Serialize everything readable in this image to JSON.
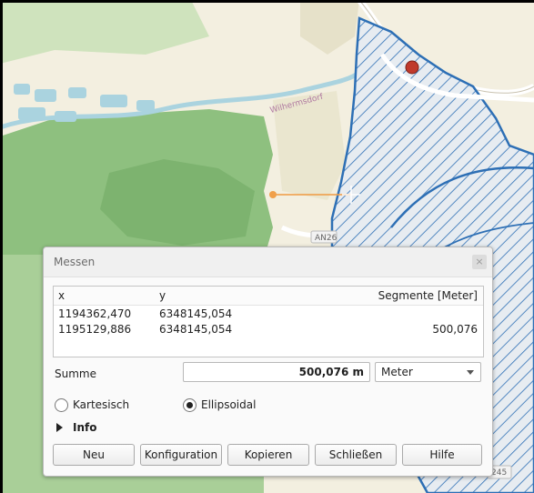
{
  "map": {
    "place_label": "Wilhermsdorf",
    "road_label_1": "AN26",
    "road_label_2": "245",
    "colors": {
      "forest": "#7fb673",
      "forest_light": "#a9d39a",
      "field": "#f0ecd8",
      "water": "#aad3df",
      "boundary": "#2d6fb5",
      "hatch": "#2d6fb5",
      "road": "#ffffff",
      "measure_line": "#f0a04b",
      "marker": "#c0392b"
    }
  },
  "dialog": {
    "title": "Messen",
    "close_icon": "×",
    "table": {
      "headers": [
        "x",
        "y",
        "Segmente [Meter]"
      ],
      "rows": [
        {
          "x": "1194362,470",
          "y": "6348145,054",
          "segment": ""
        },
        {
          "x": "1195129,886",
          "y": "6348145,054",
          "segment": "500,076"
        }
      ]
    },
    "sum_label": "Summe",
    "sum_value": "500,076 m",
    "unit_selected": "Meter",
    "radio_cartesian": "Kartesisch",
    "radio_ellipsoidal": "Ellipsoidal",
    "selected_mode": "Ellipsoidal",
    "info_label": "Info",
    "buttons": {
      "new": "Neu",
      "config": "Konfiguration",
      "copy": "Kopieren",
      "close": "Schließen",
      "help": "Hilfe"
    }
  }
}
